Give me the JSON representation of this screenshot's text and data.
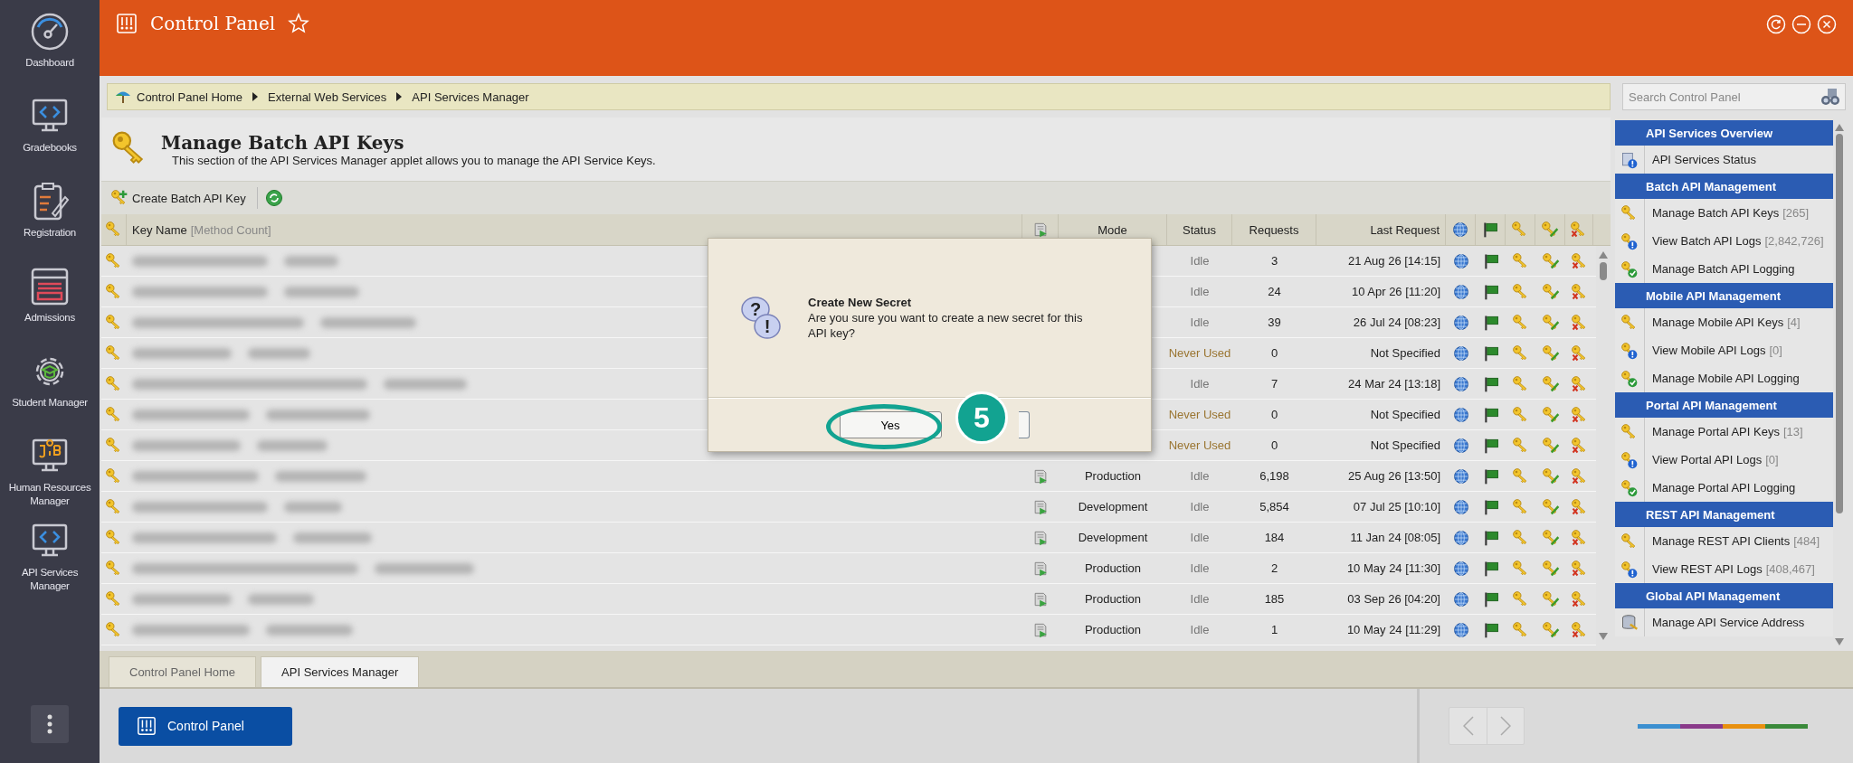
{
  "sidebar": {
    "items": [
      {
        "label": "Dashboard",
        "kind": "dashboard"
      },
      {
        "label": "Gradebooks",
        "kind": "code"
      },
      {
        "label": "Registration",
        "kind": "clipboard"
      },
      {
        "label": "Admissions",
        "kind": "browser"
      },
      {
        "label": "Student Manager",
        "kind": "gear"
      },
      {
        "label": "Human Resources Manager",
        "kind": "job"
      },
      {
        "label": "API Services Manager",
        "kind": "code"
      }
    ]
  },
  "header": {
    "title": "Control Panel"
  },
  "breadcrumb": [
    "Control Panel Home",
    "External Web Services",
    "API Services Manager"
  ],
  "search": {
    "placeholder": "Search Control Panel"
  },
  "page": {
    "title": "Manage Batch API Keys",
    "description": "This section of the API Services Manager applet allows you to manage the API Service Keys."
  },
  "toolbar": {
    "create_button": "Create Batch API Key"
  },
  "table": {
    "columns": {
      "key_name": "Key Name",
      "key_name_note": "[Method Count]",
      "mode": "Mode",
      "status": "Status",
      "requests": "Requests",
      "last_request": "Last Request"
    },
    "rows": [
      {
        "status": "Idle",
        "warning": false,
        "requests": "3",
        "last_request": "21 Aug 26 [14:15]"
      },
      {
        "status": "Idle",
        "warning": false,
        "requests": "24",
        "last_request": "10 Apr 26 [11:20]"
      },
      {
        "status": "Idle",
        "warning": false,
        "requests": "39",
        "last_request": "26 Jul 24 [08:23]"
      },
      {
        "status": "Never Used",
        "warning": true,
        "requests": "0",
        "last_request": "Not Specified"
      },
      {
        "status": "Idle",
        "warning": false,
        "requests": "7",
        "last_request": "24 Mar 24 [13:18]"
      },
      {
        "status": "Never Used",
        "warning": true,
        "requests": "0",
        "last_request": "Not Specified"
      },
      {
        "status": "Never Used",
        "warning": true,
        "requests": "0",
        "last_request": "Not Specified"
      },
      {
        "mode": "Production",
        "status": "Idle",
        "warning": false,
        "requests": "6,198",
        "last_request": "25 Aug 26 [13:50]"
      },
      {
        "mode": "Development",
        "status": "Idle",
        "warning": false,
        "requests": "5,854",
        "last_request": "07 Jul 25 [10:10]"
      },
      {
        "mode": "Development",
        "status": "Idle",
        "warning": false,
        "requests": "184",
        "last_request": "11 Jan 24 [08:05]"
      },
      {
        "mode": "Production",
        "status": "Idle",
        "warning": false,
        "requests": "2",
        "last_request": "10 May 24 [11:30]"
      },
      {
        "mode": "Production",
        "status": "Idle",
        "warning": false,
        "requests": "185",
        "last_request": "03 Sep 26 [04:20]"
      },
      {
        "mode": "Production",
        "status": "Idle",
        "warning": false,
        "requests": "1",
        "last_request": "10 May 24 [11:29]"
      }
    ]
  },
  "dialog": {
    "title": "Create New Secret",
    "message": "Are you sure you want to create a new secret for this API key?",
    "icon_marks": [
      "?",
      "!"
    ],
    "button": "Yes",
    "callout": "5"
  },
  "tabs": [
    {
      "label": "Control Panel Home",
      "selected": false
    },
    {
      "label": "API Services Manager",
      "selected": true
    }
  ],
  "taskbar": {
    "button": "Control Panel"
  },
  "right_panel": {
    "sections": [
      {
        "title": "API Services Overview",
        "items": [
          {
            "label": "API Services Status",
            "kind": "status"
          }
        ]
      },
      {
        "title": "Batch API Management",
        "items": [
          {
            "label": "Manage Batch API Keys",
            "count": "[265]",
            "kind": "key"
          },
          {
            "label": "View Batch API Logs",
            "count": "[2,842,726]",
            "kind": "log"
          },
          {
            "label": "Manage Batch API Logging",
            "kind": "logging"
          }
        ]
      },
      {
        "title": "Mobile API Management",
        "items": [
          {
            "label": "Manage Mobile API Keys",
            "count": "[4]",
            "kind": "key"
          },
          {
            "label": "View Mobile API Logs",
            "count": "[0]",
            "kind": "log"
          },
          {
            "label": "Manage Mobile API Logging",
            "kind": "logging"
          }
        ]
      },
      {
        "title": "Portal API Management",
        "items": [
          {
            "label": "Manage Portal API Keys",
            "count": "[13]",
            "kind": "key"
          },
          {
            "label": "View Portal API Logs",
            "count": "[0]",
            "kind": "log"
          },
          {
            "label": "Manage Portal API Logging",
            "kind": "logging"
          }
        ]
      },
      {
        "title": "REST API Management",
        "items": [
          {
            "label": "Manage REST API Clients",
            "count": "[484]",
            "kind": "key"
          },
          {
            "label": "View REST API Logs",
            "count": "[408,467]",
            "kind": "log"
          }
        ]
      },
      {
        "title": "Global API Management",
        "items": [
          {
            "label": "Manage API Service Address",
            "kind": "address"
          }
        ]
      }
    ]
  }
}
